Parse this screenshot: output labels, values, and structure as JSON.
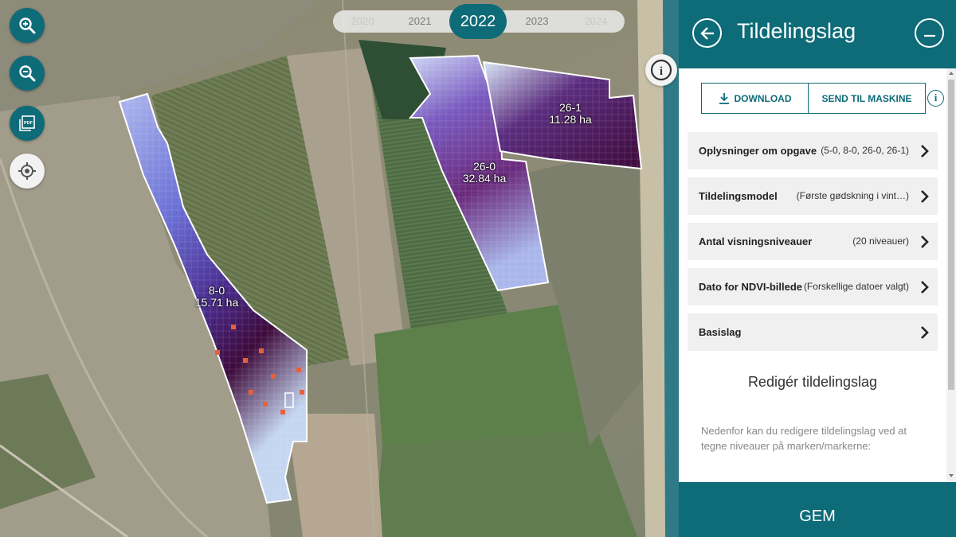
{
  "map": {
    "years": [
      "2020",
      "2021",
      "2022",
      "2023",
      "2024"
    ],
    "selected_year": "2022",
    "fields": [
      {
        "id": "8-0",
        "area": "15.71 ha"
      },
      {
        "id": "26-0",
        "area": "32.84 ha"
      },
      {
        "id": "26-1",
        "area": "11.28 ha"
      }
    ],
    "controls": [
      "zoom-in-icon",
      "zoom-out-icon",
      "pdf-icon",
      "locate-icon",
      "info-icon"
    ],
    "pdf_icon_text": "PDF",
    "info_glyph": "i"
  },
  "panel": {
    "title": "Tildelingslag",
    "download_label": "DOWNLOAD",
    "send_label": "SEND TIL MASKINE",
    "info_glyph": "i",
    "rows": [
      {
        "label": "Oplysninger om opgave",
        "value": "(5-0, 8-0, 26-0, 26-1)"
      },
      {
        "label": "Tildelingsmodel",
        "value": "(Første gødskning i vint…)"
      },
      {
        "label": "Antal visningsniveauer",
        "value": "(20 niveauer)"
      },
      {
        "label": "Dato for NDVI-billede",
        "value": "(Forskellige datoer valgt)"
      },
      {
        "label": "Basislag",
        "value": ""
      }
    ],
    "edit_title": "Redigér tildelingslag",
    "edit_description": "Nedenfor kan du redigere tildelingslag ved at tegne niveauer på marken/markerne:",
    "save_label": "GEM"
  },
  "colors": {
    "accent": "#0e6b78",
    "level_low": "#e8f2fa",
    "level_mid": "#5a63c8",
    "level_high": "#3d0a3a",
    "level_extra": "#e8603a"
  }
}
